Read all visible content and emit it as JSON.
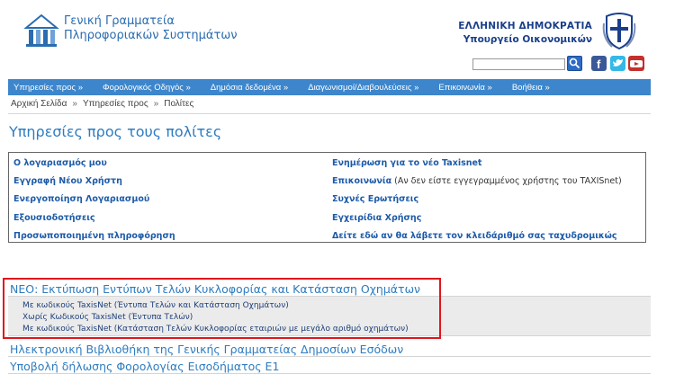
{
  "header": {
    "logo_line1": "Γενική Γραμματεία",
    "logo_line2": "Πληροφοριακών Συστημάτων",
    "gov_title": "ΕΛΛΗΝΙΚΗ ΔΗΜΟΚΡΑΤΙΑ",
    "gov_subtitle": "Υπουργείο Οικονομικών",
    "search_placeholder": "",
    "icons": [
      "gsis-logo-icon",
      "greek-emblem-icon",
      "search-icon",
      "facebook-icon",
      "twitter-icon",
      "youtube-icon"
    ]
  },
  "nav": {
    "items": [
      "Υπηρεσίες προς »",
      "Φορολογικός Οδηγός »",
      "Δημόσια δεδομένα »",
      "Διαγωνισμοί/Διαβουλεύσεις »",
      "Επικοινωνία »",
      "Βοήθεια »"
    ]
  },
  "breadcrumb": {
    "items": [
      "Αρχική Σελίδα",
      "Υπηρεσίες προς",
      "Πολίτες"
    ],
    "separator": "»"
  },
  "page_title": "Υπηρεσίες προς τους πολίτες",
  "links": {
    "left": [
      "Ο λογαριασμός μου",
      "Εγγραφή Νέου Χρήστη",
      "Ενεργοποίηση Λογαριασμού",
      "Εξουσιοδοτήσεις",
      "Προσωποποιημένη πληροφόρηση"
    ],
    "right": [
      "Ενημέρωση για το νέο Taxisnet",
      "Επικοινωνία",
      "Συχνές Ερωτήσεις",
      "Εγχειρίδια Χρήσης",
      "Δείτε εδώ αν θα λάβετε τον κλειδάριθμό σας ταχυδρομικώς"
    ],
    "right_note": " (Αν δεν είστε εγγεγραμμένος χρήστης του TAXISnet)"
  },
  "new_section": {
    "title": "ΝΕΟ: Εκτύπωση Εντύπων Τελών Κυκλοφορίας και Κατάσταση Οχημάτων",
    "items": [
      "Με κωδικούς TaxisNet  (Έντυπα Τελών και Κατάσταση Οχημάτων)",
      "Χωρίς Κωδικούς TaxisNet (Έντυπα Τελών)",
      "Με κωδικούς TaxisNet  (Κατάσταση Τελών Κυκλοφορίας εταιριών με μεγάλο αριθμό οχημάτων)"
    ]
  },
  "library_title": "Ηλεκτρονική Βιβλιοθήκη της Γενικής Γραμματείας Δημοσίων Εσόδων",
  "tax_title": "Υποβολή δήλωσης Φορολογίας Εισοδήματος Ε1",
  "colors": {
    "nav_bg": "#3d86cc",
    "link": "#1d5ba8",
    "title": "#2e7cc0",
    "highlight_frame": "#e0161d"
  }
}
